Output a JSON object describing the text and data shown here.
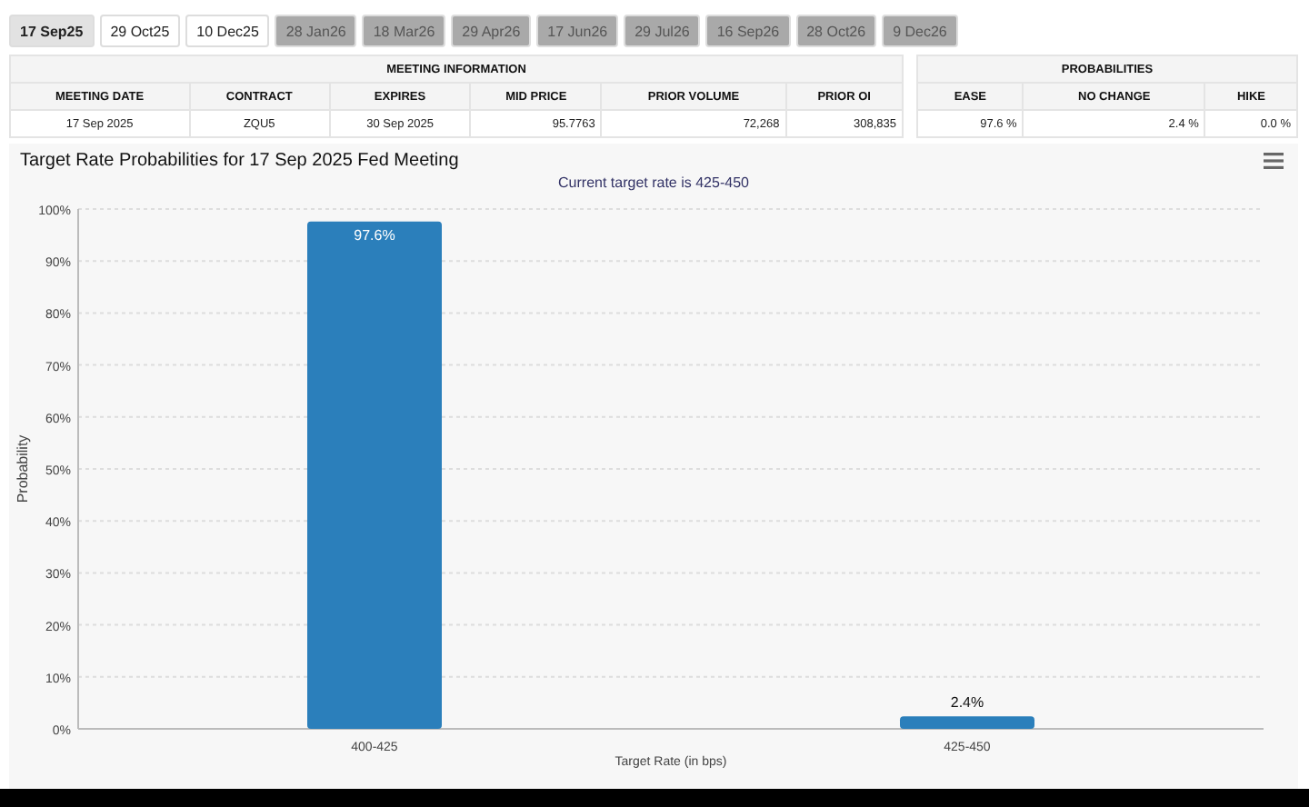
{
  "tabs": [
    {
      "label": "17 Sep25",
      "selected": true,
      "disabled": false
    },
    {
      "label": "29 Oct25",
      "selected": false,
      "disabled": false
    },
    {
      "label": "10 Dec25",
      "selected": false,
      "disabled": false
    },
    {
      "label": "28 Jan26",
      "selected": false,
      "disabled": true
    },
    {
      "label": "18 Mar26",
      "selected": false,
      "disabled": true
    },
    {
      "label": "29 Apr26",
      "selected": false,
      "disabled": true
    },
    {
      "label": "17 Jun26",
      "selected": false,
      "disabled": true
    },
    {
      "label": "29 Jul26",
      "selected": false,
      "disabled": true
    },
    {
      "label": "16 Sep26",
      "selected": false,
      "disabled": true
    },
    {
      "label": "28 Oct26",
      "selected": false,
      "disabled": true
    },
    {
      "label": "9 Dec26",
      "selected": false,
      "disabled": true
    }
  ],
  "meeting_table": {
    "title": "MEETING INFORMATION",
    "columns": [
      "MEETING DATE",
      "CONTRACT",
      "EXPIRES",
      "MID PRICE",
      "PRIOR VOLUME",
      "PRIOR OI"
    ],
    "row": [
      "17 Sep 2025",
      "ZQU5",
      "30 Sep 2025",
      "95.7763",
      "72,268",
      "308,835"
    ]
  },
  "probabilities_table": {
    "title": "PROBABILITIES",
    "columns": [
      "EASE",
      "NO CHANGE",
      "HIKE"
    ],
    "row": [
      "97.6 %",
      "2.4 %",
      "0.0 %"
    ]
  },
  "chart": {
    "title": "Target Rate Probabilities for 17 Sep 2025 Fed Meeting",
    "subtitle": "Current target rate is 425-450",
    "chart_data": {
      "type": "bar",
      "xlabel": "Target Rate (in bps)",
      "ylabel": "Probability",
      "categories": [
        "400-425",
        "425-450"
      ],
      "values": [
        97.6,
        2.4
      ],
      "grid": true,
      "ylim": [
        0,
        100
      ],
      "yticks": [
        {
          "value": 0,
          "label": "0%"
        },
        {
          "value": 10,
          "label": "10%"
        },
        {
          "value": 20,
          "label": "20%"
        },
        {
          "value": 30,
          "label": "30%"
        },
        {
          "value": 40,
          "label": "40%"
        },
        {
          "value": 50,
          "label": "50%"
        },
        {
          "value": 60,
          "label": "60%"
        },
        {
          "value": 70,
          "label": "70%"
        },
        {
          "value": 80,
          "label": "80%"
        },
        {
          "value": 90,
          "label": "90%"
        },
        {
          "value": 100,
          "label": "100%"
        }
      ],
      "value_labels": [
        "97.6%",
        "2.4%"
      ]
    }
  }
}
